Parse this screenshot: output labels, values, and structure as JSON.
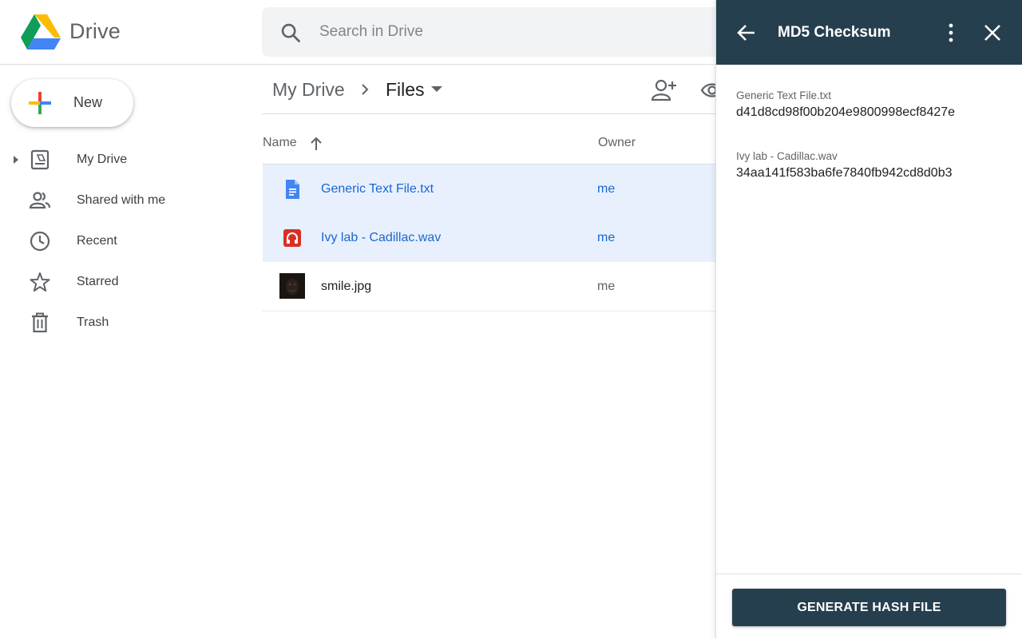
{
  "header": {
    "brand": "Drive",
    "search": {
      "placeholder": "Search in Drive",
      "value": ""
    }
  },
  "sidebar": {
    "new_label": "New",
    "items": [
      {
        "label": "My Drive",
        "icon": "my-drive-icon"
      },
      {
        "label": "Shared with me",
        "icon": "shared-icon"
      },
      {
        "label": "Recent",
        "icon": "clock-icon"
      },
      {
        "label": "Starred",
        "icon": "star-icon"
      },
      {
        "label": "Trash",
        "icon": "trash-icon"
      }
    ]
  },
  "main": {
    "breadcrumb": {
      "root": "My Drive",
      "current": "Files"
    },
    "columns": {
      "name": "Name",
      "owner": "Owner"
    },
    "files": [
      {
        "name": "Generic Text File.txt",
        "owner": "me",
        "type": "doc",
        "selected": true
      },
      {
        "name": "Ivy lab - Cadillac.wav",
        "owner": "me",
        "type": "audio",
        "selected": true
      },
      {
        "name": "smile.jpg",
        "owner": "me",
        "type": "image",
        "selected": false
      }
    ]
  },
  "panel": {
    "title": "MD5 Checksum",
    "hashes": [
      {
        "filename": "Generic Text File.txt",
        "hash": "d41d8cd98f00b204e9800998ecf8427e"
      },
      {
        "filename": "Ivy lab - Cadillac.wav",
        "hash": "34aa141f583ba6fe7840fb942cd8d0b3"
      }
    ],
    "generate_label": "GENERATE HASH FILE"
  },
  "colors": {
    "panel_header": "#263f4f",
    "selection": "#e8f0fe",
    "link_blue": "#1967d2",
    "doc_blue": "#4285f4",
    "audio_red": "#d93025"
  }
}
